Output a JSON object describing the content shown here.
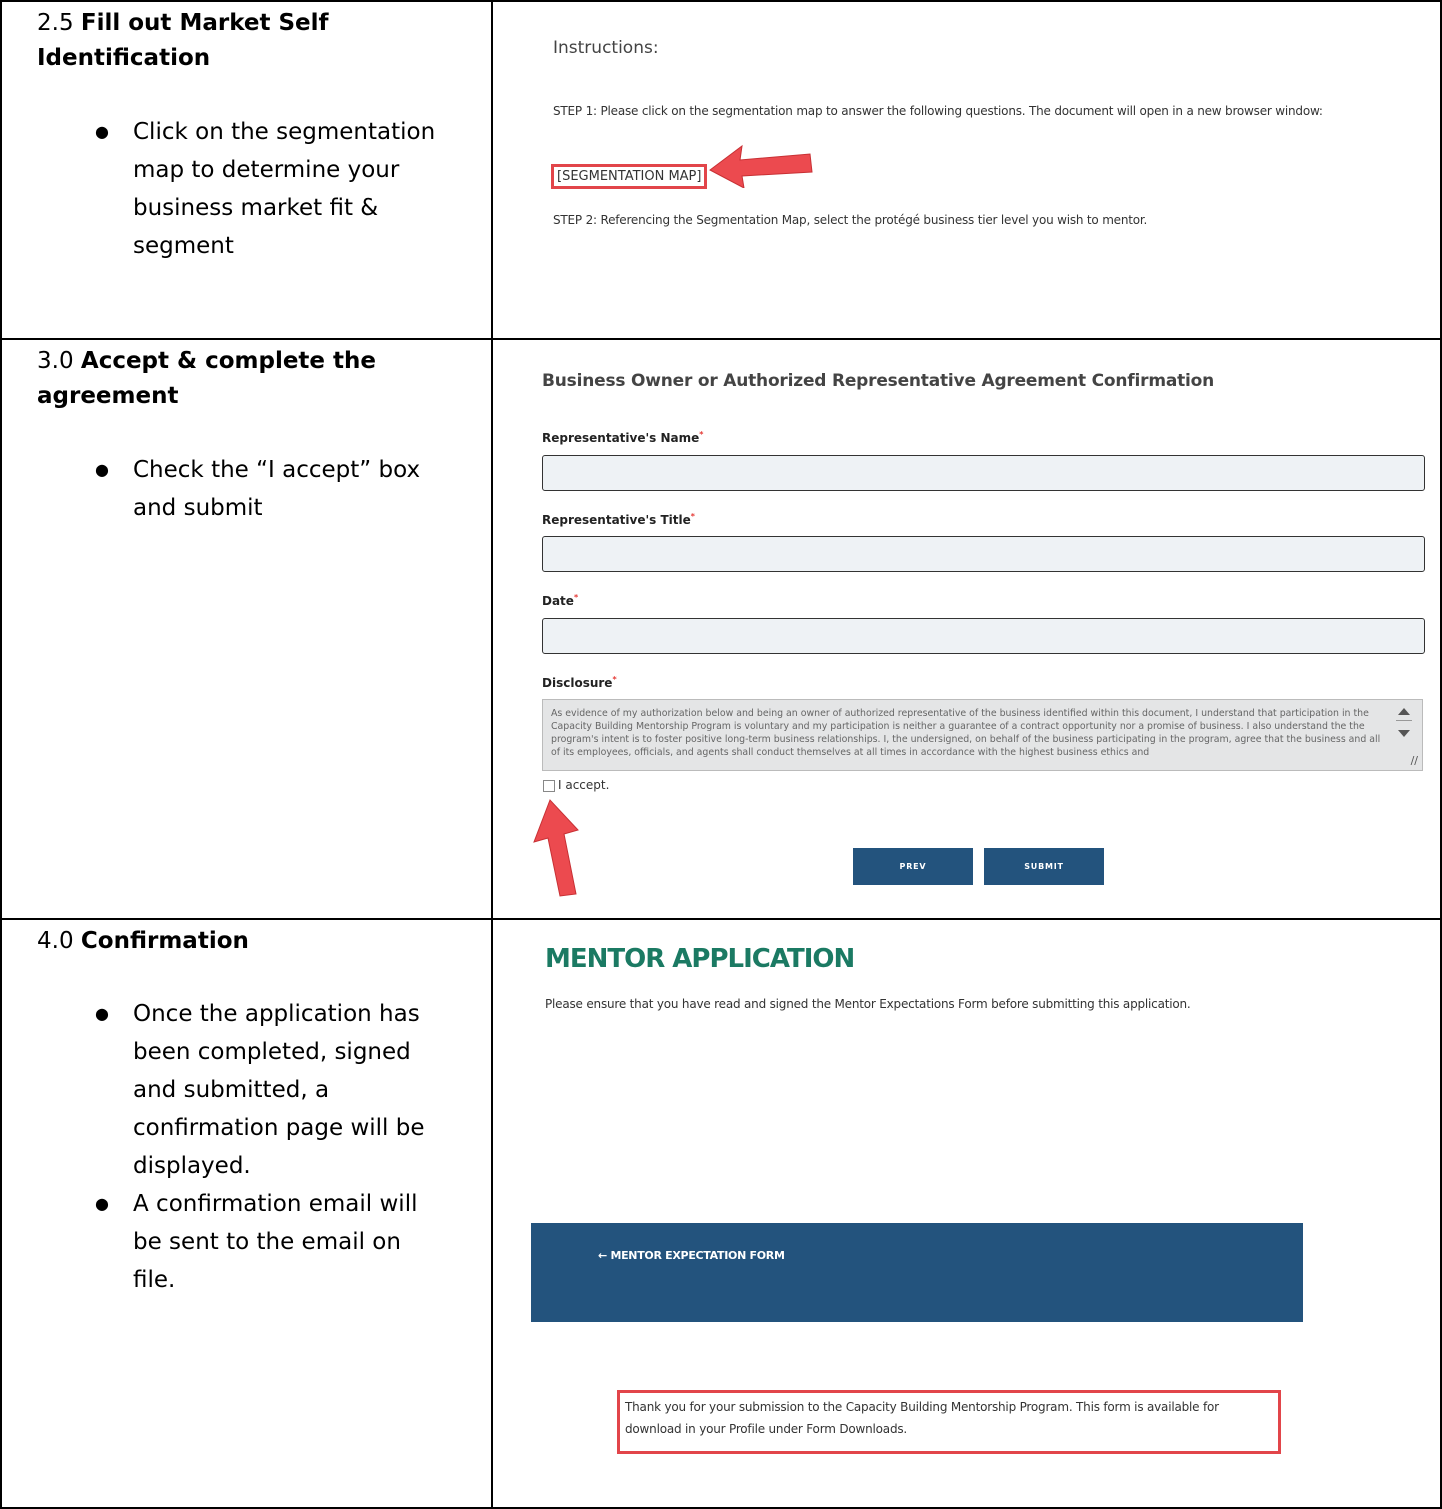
{
  "rows": [
    {
      "number": "2.5",
      "title": "Fill out Market Self Identification",
      "bullets": [
        "Click on the segmentation map to determine your business market fit & segment"
      ]
    },
    {
      "number": "3.0",
      "title": "Accept & complete the agreement",
      "bullets": [
        "Check the “I accept” box and submit"
      ]
    },
    {
      "number": "4.0",
      "title": "Confirmation",
      "bullets": [
        "Once the application has been completed, signed and submitted, a confirmation page will be displayed.",
        "A confirmation email will be sent to the email on file."
      ]
    }
  ],
  "segmentation": {
    "heading": "Instructions:",
    "step1": "STEP 1: Please click on the segmentation map to answer the following questions. The document will open in a new browser window:",
    "link": "[SEGMENTATION MAP]",
    "step2": "STEP 2: Referencing the Segmentation Map, select the protégé business tier level you wish to mentor."
  },
  "agreement": {
    "heading": "Business Owner or Authorized Representative Agreement Confirmation",
    "name_label": "Representative's Name",
    "title_label": "Representative's Title",
    "date_label": "Date",
    "disclosure_label": "Disclosure",
    "required_mark": "*",
    "disclosure_text": "As evidence of my authorization below and being an owner of authorized representative of the business identified within this document, I understand that participation in the Capacity Building Mentorship Program is voluntary and my participation is neither a guarantee of a contract opportunity nor a promise of business. I also understand the the program's intent is to foster positive long-term business relationships. I, the undersigned, on behalf of the business participating in the program, agree that the business and all of its employees, officials, and agents shall conduct themselves at all times in accordance with the highest business ethics and",
    "accept_label": "I accept.",
    "prev_label": "PREV",
    "submit_label": "SUBMIT"
  },
  "confirmation": {
    "heading": "MENTOR APPLICATION",
    "subtext": "Please ensure that you have read and signed the Mentor Expectations Form before submitting this application.",
    "back_link": "← MENTOR EXPECTATION FORM",
    "thanks": "Thank you for your submission to the Capacity Building Mentorship Program. This form is available for download in your Profile under Form Downloads."
  },
  "colors": {
    "highlight": "#e2454a",
    "button": "#23537d",
    "heading_green": "#1b7a63"
  },
  "icons": [
    "red-arrow-icon",
    "checkbox-icon",
    "scroll-up-icon",
    "scroll-down-icon",
    "resize-handle-icon"
  ]
}
